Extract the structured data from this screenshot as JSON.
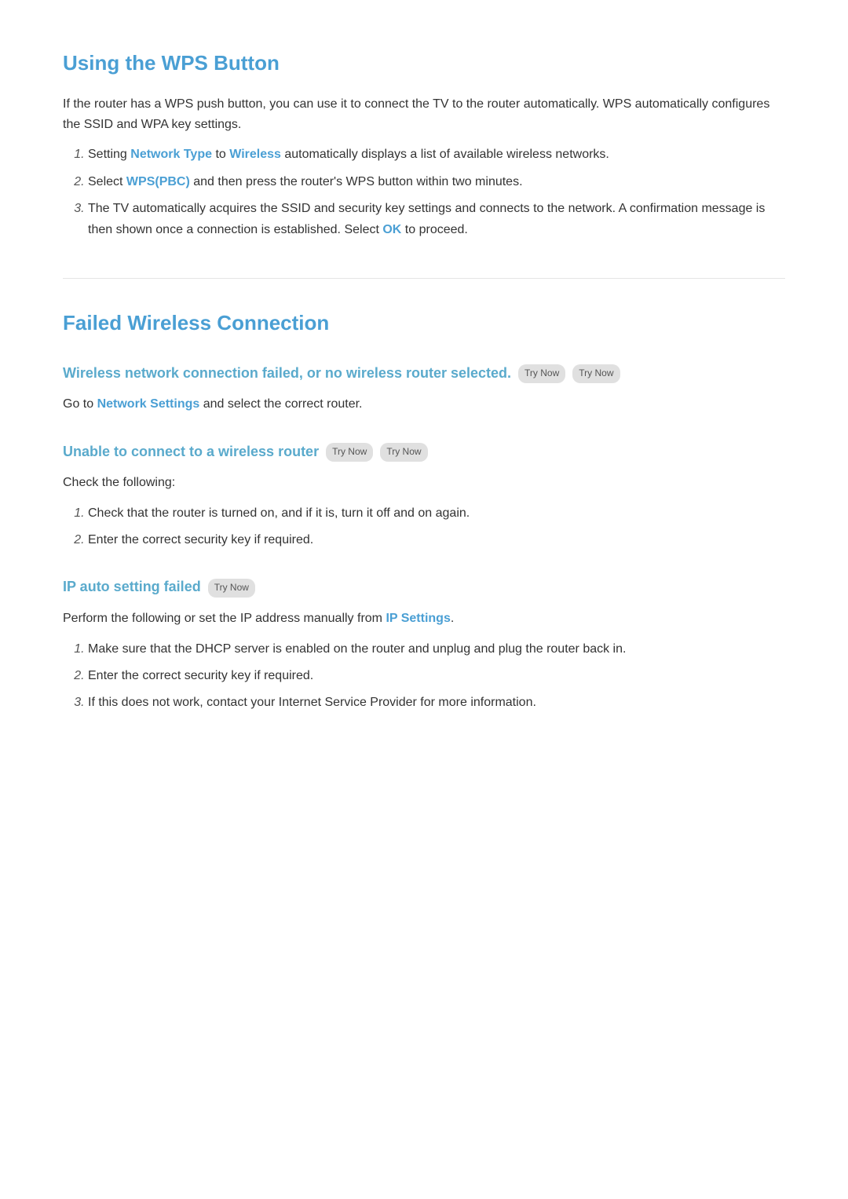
{
  "wps_section": {
    "title": "Using the WPS Button",
    "intro": "If the router has a WPS push button, you can use it to connect the TV to the router automatically. WPS automatically configures the SSID and WPA key settings.",
    "steps": [
      {
        "text_before": "Setting ",
        "link1": "Network Type",
        "text_middle1": " to ",
        "link2": "Wireless",
        "text_after": " automatically displays a list of available wireless networks."
      },
      {
        "text_before": "Select ",
        "link1": "WPS(PBC)",
        "text_after": " and then press the router's WPS button within two minutes."
      },
      {
        "text_before": "The TV automatically acquires the SSID and security key settings and connects to the network. A confirmation message is then shown once a connection is established. Select ",
        "link1": "OK",
        "text_after": " to proceed."
      }
    ]
  },
  "failed_section": {
    "title": "Failed Wireless Connection",
    "subsections": [
      {
        "id": "no-router",
        "subtitle": "Wireless network connection failed, or no wireless router selected.",
        "try_now_badges": [
          "Try Now",
          "Try Now"
        ],
        "paragraphs": [
          {
            "text_before": "Go to ",
            "link": "Network Settings",
            "text_after": " and select the correct router."
          }
        ],
        "steps": []
      },
      {
        "id": "unable-connect",
        "subtitle": "Unable to connect to a wireless router",
        "try_now_badges": [
          "Try Now",
          "Try Now"
        ],
        "paragraphs": [
          {
            "text_before": "Check the following:",
            "link": "",
            "text_after": ""
          }
        ],
        "steps": [
          "Check that the router is turned on, and if it is, turn it off and on again.",
          "Enter the correct security key if required."
        ]
      },
      {
        "id": "ip-failed",
        "subtitle": "IP auto setting failed",
        "try_now_badges": [
          "Try Now"
        ],
        "paragraphs": [
          {
            "text_before": "Perform the following or set the IP address manually from ",
            "link": "IP Settings",
            "text_after": "."
          }
        ],
        "steps": [
          "Make sure that the DHCP server is enabled on the router and unplug and plug the router back in.",
          "Enter the correct security key if required.",
          "If this does not work, contact your Internet Service Provider for more information."
        ]
      }
    ]
  },
  "labels": {
    "try_now": "Try Now"
  }
}
